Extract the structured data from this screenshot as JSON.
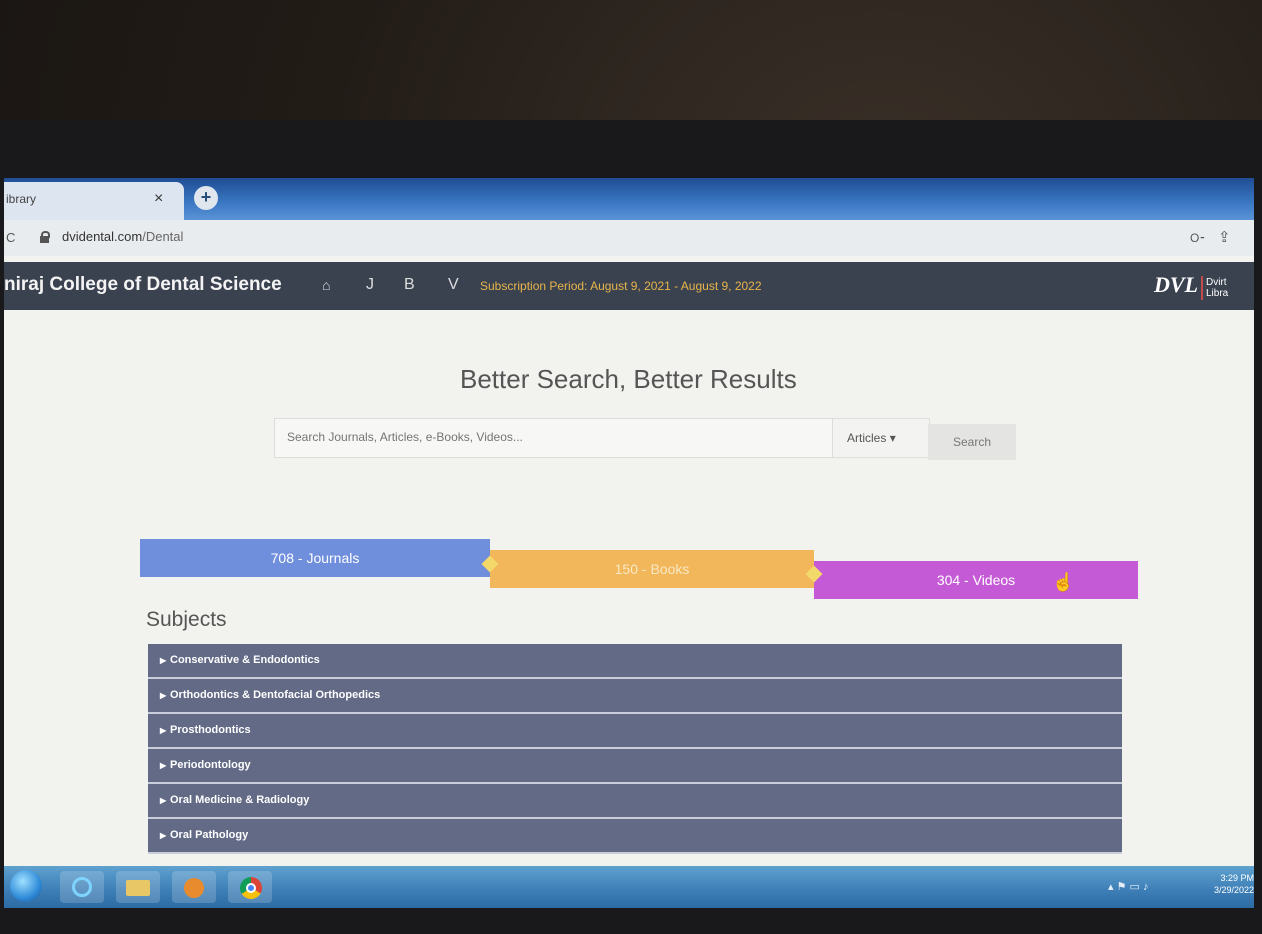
{
  "browser": {
    "tab_title": "ibrary",
    "tab_close": "×",
    "new_tab": "+",
    "url_domain": "dvidental.com",
    "url_path": "/Dental"
  },
  "header": {
    "brand": "niraj College of Dental Science",
    "nav": {
      "journals": "J",
      "books": "B",
      "videos": "V"
    },
    "subscription": "Subscription Period: August 9, 2021 - August 9, 2022",
    "logo_mark": "DVL",
    "logo_line1": "Dvirt",
    "logo_line2": "Libra"
  },
  "hero": {
    "title": "Better Search, Better Results",
    "search_placeholder": "Search Journals, Articles, e-Books, Videos...",
    "dropdown_value": "Articles",
    "search_button": "Search"
  },
  "stats": {
    "journals": "708 - Journals",
    "books": "150 - Books",
    "videos": "304 - Videos"
  },
  "subjects": {
    "title": "Subjects",
    "items": [
      "Conservative & Endodontics",
      "Orthodontics & Dentofacial Orthopedics",
      "Prosthodontics",
      "Periodontology",
      "Oral Medicine & Radiology",
      "Oral Pathology"
    ]
  },
  "taskbar": {
    "time": "3:29 PM",
    "date": "3/29/2022"
  },
  "colors": {
    "header_bg": "#3a4250",
    "subscription": "#e8b54a",
    "journals": "#6f8fdc",
    "books": "#f2b65b",
    "videos": "#c55ad6",
    "subject_row": "#626a86"
  }
}
